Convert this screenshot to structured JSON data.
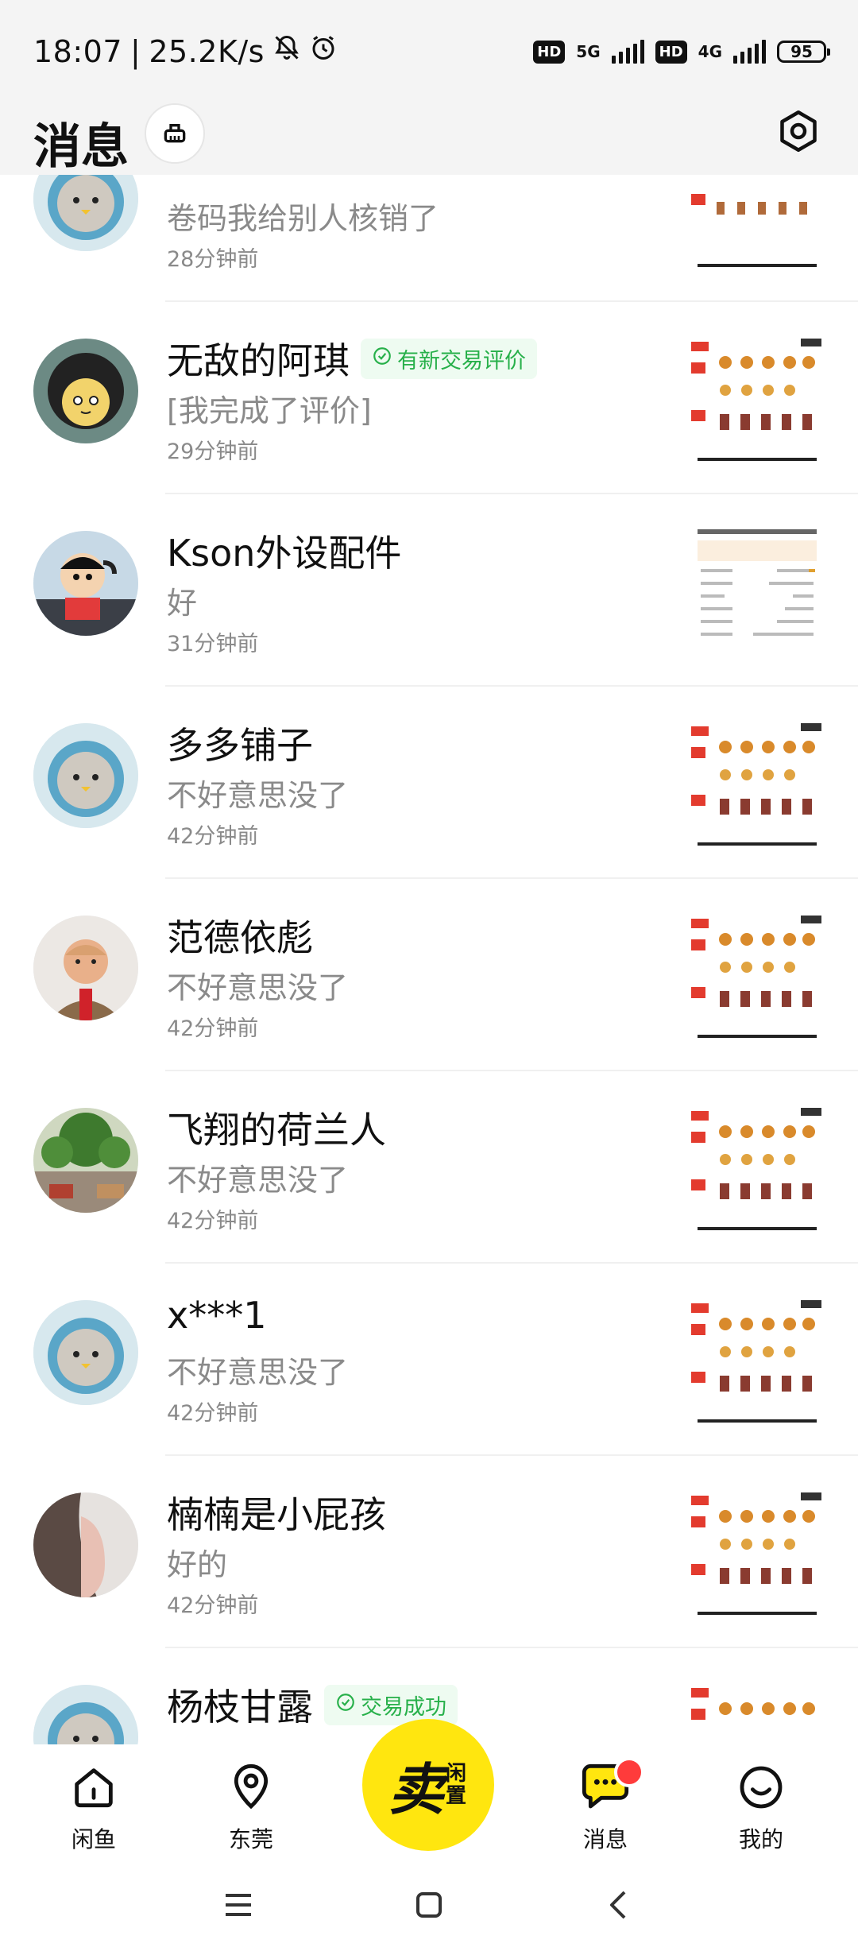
{
  "status_bar": {
    "time": "18:07",
    "speed": "25.2K/s",
    "hd1": "HD",
    "net1": "5G",
    "hd2": "HD",
    "net2": "4G",
    "battery": "95"
  },
  "header": {
    "title": "消息"
  },
  "conversations": [
    {
      "name": "",
      "preview": "卷码我给别人核销了",
      "time": "28分钟前",
      "tag": ""
    },
    {
      "name": "无敌的阿琪",
      "preview": "[我完成了评价]",
      "time": "29分钟前",
      "tag": "有新交易评价"
    },
    {
      "name": "Kson外设配件",
      "preview": "好",
      "time": "31分钟前",
      "tag": ""
    },
    {
      "name": "多多铺子",
      "preview": "不好意思没了",
      "time": "42分钟前",
      "tag": ""
    },
    {
      "name": "范德依彪",
      "preview": "不好意思没了",
      "time": "42分钟前",
      "tag": ""
    },
    {
      "name": "飞翔的荷兰人",
      "preview": "不好意思没了",
      "time": "42分钟前",
      "tag": ""
    },
    {
      "name": "x***1",
      "preview": "不好意思没了",
      "time": "42分钟前",
      "tag": ""
    },
    {
      "name": "楠楠是小屁孩",
      "preview": "好的",
      "time": "42分钟前",
      "tag": ""
    },
    {
      "name": "杨枝甘露",
      "preview": "",
      "time": "",
      "tag": "交易成功"
    }
  ],
  "bottom_nav": {
    "home": "闲鱼",
    "city": "东莞",
    "sell_main": "卖",
    "sell_sub": "闲置",
    "messages": "消息",
    "mine": "我的"
  },
  "colors": {
    "accent_yellow": "#ffe60f",
    "tag_green": "#27b04a",
    "badge_red": "#ff3b3b"
  },
  "icons": [
    "mute-icon",
    "alarm-icon",
    "clean-icon",
    "settings-icon",
    "home-icon",
    "location-icon",
    "chat-icon",
    "profile-icon"
  ]
}
